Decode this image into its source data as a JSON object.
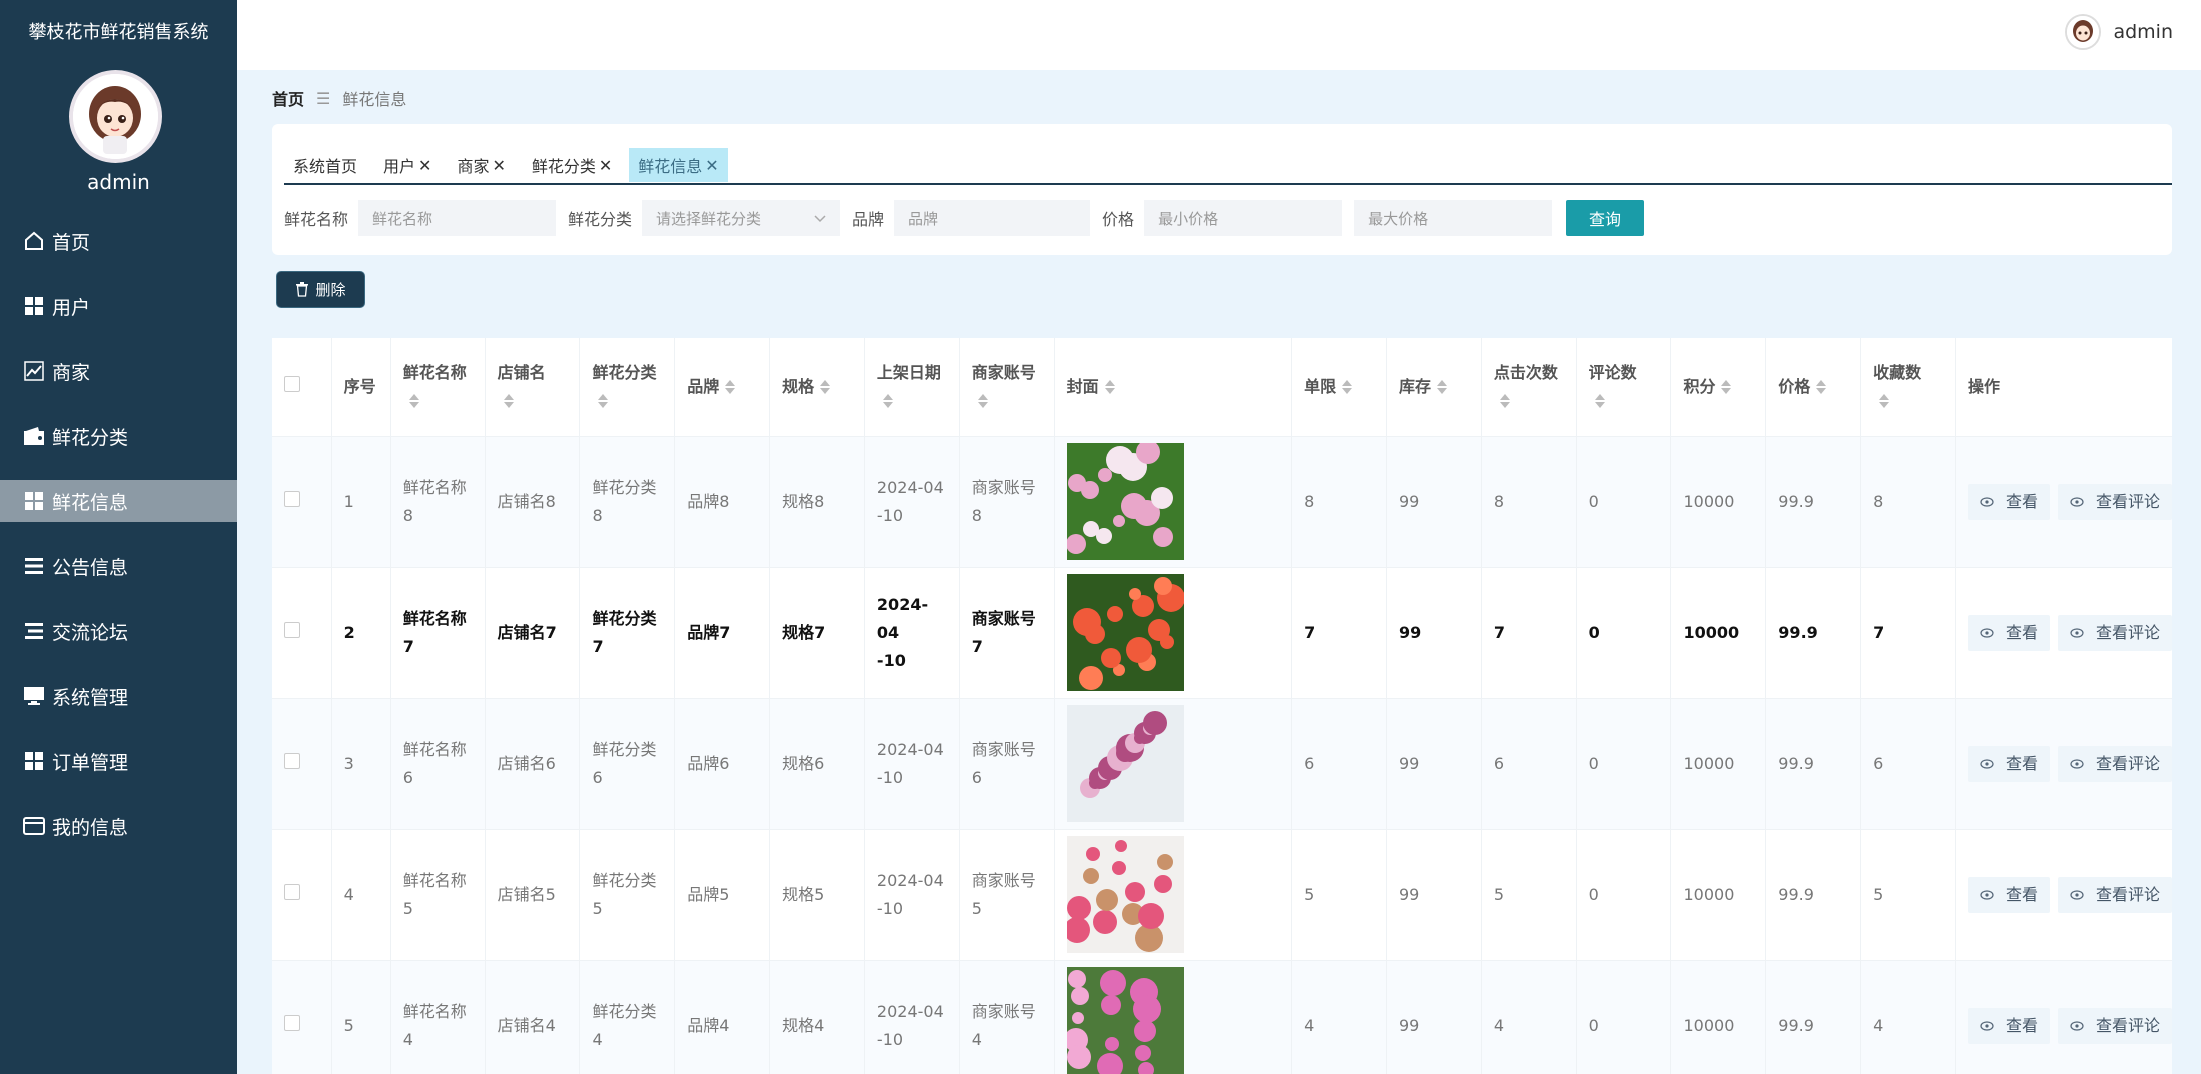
{
  "app": {
    "title": "攀枝花市鲜花销售系统",
    "username": "admin"
  },
  "topbar": {
    "username": "admin"
  },
  "menu": [
    {
      "label": "首页",
      "icon": "home-icon"
    },
    {
      "label": "用户",
      "icon": "grid-icon"
    },
    {
      "label": "商家",
      "icon": "chart-icon"
    },
    {
      "label": "鲜花分类",
      "icon": "wallet-icon"
    },
    {
      "label": "鲜花信息",
      "icon": "grid-icon"
    },
    {
      "label": "公告信息",
      "icon": "list-icon"
    },
    {
      "label": "交流论坛",
      "icon": "list-icon"
    },
    {
      "label": "系统管理",
      "icon": "monitor-icon"
    },
    {
      "label": "订单管理",
      "icon": "grid-icon"
    },
    {
      "label": "我的信息",
      "icon": "card-icon"
    }
  ],
  "breadcrumb": {
    "home": "首页",
    "current": "鲜花信息"
  },
  "tabs": [
    {
      "label": "系统首页",
      "closable": false
    },
    {
      "label": "用户",
      "closable": true
    },
    {
      "label": "商家",
      "closable": true
    },
    {
      "label": "鲜花分类",
      "closable": true
    },
    {
      "label": "鲜花信息",
      "closable": true
    }
  ],
  "search": {
    "name_label": "鲜花名称",
    "name_placeholder": "鲜花名称",
    "category_label": "鲜花分类",
    "category_placeholder": "请选择鲜花分类",
    "brand_label": "品牌",
    "brand_placeholder": "品牌",
    "price_label": "价格",
    "min_price_placeholder": "最小价格",
    "max_price_placeholder": "最大价格",
    "query_button": "查询"
  },
  "delete_button": "删除",
  "table": {
    "headers": [
      "序号",
      "鲜花名称",
      "店铺名",
      "鲜花分类",
      "品牌",
      "规格",
      "上架日期",
      "商家账号",
      "封面",
      "单限",
      "库存",
      "点击次数",
      "评论数",
      "积分",
      "价格",
      "收藏数",
      "操作"
    ],
    "actions": {
      "view": "查看",
      "view_comments": "查看评论"
    },
    "rows": [
      {
        "no": "1",
        "name": [
          "鲜花名称",
          "8"
        ],
        "shop": "店铺名8",
        "category": [
          "鲜花分类",
          "8"
        ],
        "brand": "品牌8",
        "spec": "规格8",
        "date": [
          "2024-04",
          "-10"
        ],
        "account": [
          "商家账号",
          "8"
        ],
        "limit": "8",
        "stock": "99",
        "clicks": "8",
        "comments": "0",
        "points": "10000",
        "price": "99.9",
        "favorites": "8",
        "palette": [
          "#3d7a2a",
          "#e8a6c9",
          "#f5e7ef"
        ]
      },
      {
        "no": "2",
        "name": [
          "鲜花名称",
          "7"
        ],
        "shop": "店铺名7",
        "category": [
          "鲜花分类",
          "7"
        ],
        "brand": "品牌7",
        "spec": "规格7",
        "date": [
          "2024-04",
          "-10"
        ],
        "account": [
          "商家账号",
          "7"
        ],
        "limit": "7",
        "stock": "99",
        "clicks": "7",
        "comments": "0",
        "points": "10000",
        "price": "99.9",
        "favorites": "7",
        "palette": [
          "#2f5a1f",
          "#f05a3a",
          "#ff7d55"
        ]
      },
      {
        "no": "3",
        "name": [
          "鲜花名称",
          "6"
        ],
        "shop": "店铺名6",
        "category": [
          "鲜花分类",
          "6"
        ],
        "brand": "品牌6",
        "spec": "规格6",
        "date": [
          "2024-04",
          "-10"
        ],
        "account": [
          "商家账号",
          "6"
        ],
        "limit": "6",
        "stock": "99",
        "clicks": "6",
        "comments": "0",
        "points": "10000",
        "price": "99.9",
        "favorites": "6",
        "palette": [
          "#e9eef2",
          "#b04c80",
          "#e7b1cf"
        ]
      },
      {
        "no": "4",
        "name": [
          "鲜花名称",
          "5"
        ],
        "shop": "店铺名5",
        "category": [
          "鲜花分类",
          "5"
        ],
        "brand": "品牌5",
        "spec": "规格5",
        "date": [
          "2024-04",
          "-10"
        ],
        "account": [
          "商家账号",
          "5"
        ],
        "limit": "5",
        "stock": "99",
        "clicks": "5",
        "comments": "0",
        "points": "10000",
        "price": "99.9",
        "favorites": "5",
        "palette": [
          "#f2f0ee",
          "#e4567c",
          "#c9926a"
        ]
      },
      {
        "no": "5",
        "name": [
          "鲜花名称",
          "4"
        ],
        "shop": "店铺名4",
        "category": [
          "鲜花分类",
          "4"
        ],
        "brand": "品牌4",
        "spec": "规格4",
        "date": [
          "2024-04",
          "-10"
        ],
        "account": [
          "商家账号",
          "4"
        ],
        "limit": "4",
        "stock": "99",
        "clicks": "4",
        "comments": "0",
        "points": "10000",
        "price": "99.9",
        "favorites": "4",
        "palette": [
          "#4d7a3a",
          "#e06bb5",
          "#f2a9d4"
        ]
      }
    ]
  }
}
